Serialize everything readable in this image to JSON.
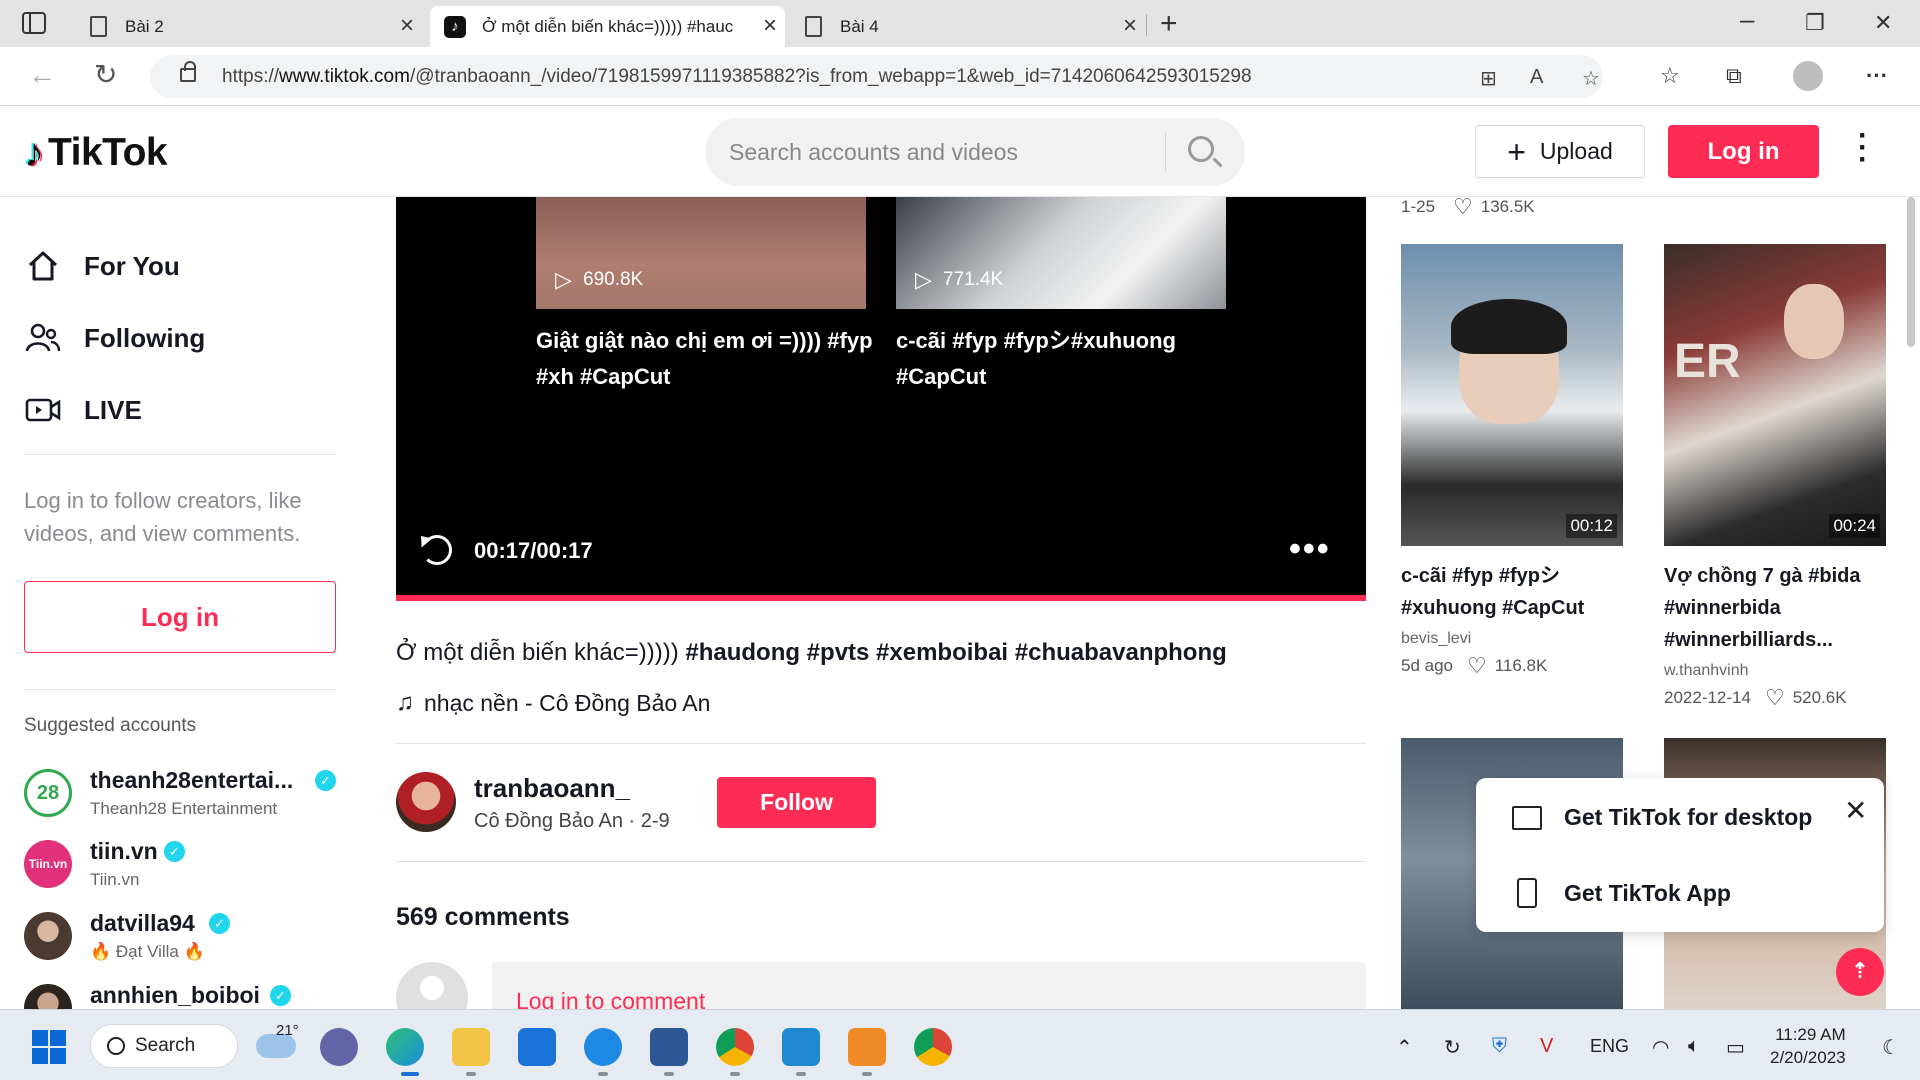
{
  "browser": {
    "tabs": [
      {
        "title": "Bài 2",
        "close": "×"
      },
      {
        "title": "Ở một diễn biến khác=))))) #hauc",
        "close": "×"
      },
      {
        "title": "Bài 4",
        "close": "×"
      }
    ],
    "new_tab": "+",
    "url_prefix": "https://",
    "url_host": "www.tiktok.com",
    "url_path": "/@tranbaoann_/video/7198159971119385882?is_from_webapp=1&web_id=7142060642593015298"
  },
  "header": {
    "logo_text": "TikTok",
    "search_placeholder": "Search accounts and videos",
    "upload_label": "Upload",
    "login_label": "Log in"
  },
  "sidebar": {
    "nav": [
      {
        "label": "For You"
      },
      {
        "label": "Following"
      },
      {
        "label": "LIVE"
      }
    ],
    "login_prompt": "Log in to follow creators, like videos, and view comments.",
    "login_button": "Log in",
    "suggested_title": "Suggested accounts",
    "accounts": [
      {
        "username": "theanh28entertai...",
        "display": "Theanh28 Entertainment",
        "verified": true,
        "avatar_color": "#2fa84f"
      },
      {
        "username": "tiin.vn",
        "display": "Tiin.vn",
        "verified": true,
        "avatar_color": "#e0317a"
      },
      {
        "username": "datvilla94",
        "display": "🔥 Đạt Villa 🔥",
        "verified": true,
        "avatar_color": "#5a4a3f"
      },
      {
        "username": "annhien_boiboi",
        "display": "",
        "verified": true,
        "avatar_color": "#3b2f2a"
      }
    ]
  },
  "video": {
    "related": [
      {
        "views": "690.8K",
        "title": "Giật giật nào chị em ơi =)))) #fyp #xh #CapCut"
      },
      {
        "views": "771.4K",
        "title": "c-cãi #fyp #fypシ#xuhuong #CapCut"
      }
    ],
    "time": "00:17/00:17",
    "more": "•••"
  },
  "post": {
    "description_prefix": "Ở một diễn biến khác=)))))",
    "hashtags": "#haudong #pvts #xemboibai #chuabavanphong",
    "music": "nhạc nền - Cô Đồng Bảo An",
    "author": "tranbaoann_",
    "author_sub": "Cô Đồng Bảo An · 2-9",
    "follow_label": "Follow",
    "comments_count": "569 comments",
    "comment_prompt": "Log in to comment"
  },
  "recommendations": {
    "top_meta": {
      "date": "1-25",
      "likes": "136.5K"
    },
    "cards": [
      {
        "duration": "00:12",
        "title": "c-cãi #fyp #fypシ #xuhuong #CapCut",
        "author": "bevis_levi",
        "date": "5d ago",
        "likes": "116.8K"
      },
      {
        "duration": "00:24",
        "title": "Vợ chồng 7 gà #bida #winnerbida #winnerbilliards...",
        "author": "w.thanhvinh",
        "date": "2022-12-14",
        "likes": "520.6K"
      }
    ]
  },
  "popup": {
    "desktop_label": "Get TikTok for desktop",
    "app_label": "Get TikTok App",
    "close": "✕"
  },
  "taskbar": {
    "search_label": "Search",
    "temperature": "21°",
    "language": "ENG",
    "time": "11:29 AM",
    "date": "2/20/2023"
  },
  "colors": {
    "brand": "#fe2c55",
    "verified": "#20d5ec"
  }
}
